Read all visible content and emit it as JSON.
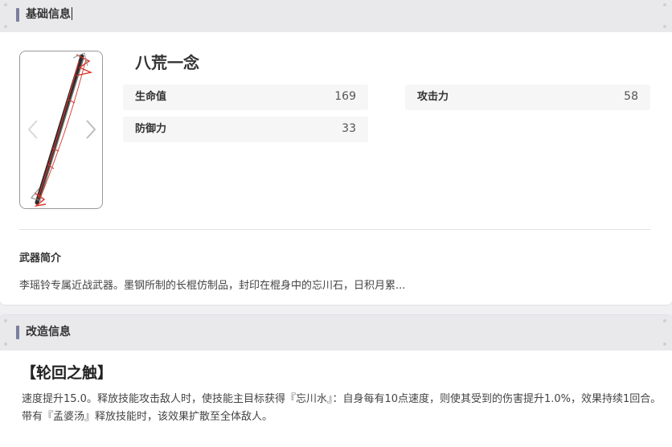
{
  "basic": {
    "header_title": "基础信息",
    "weapon_name": "八荒一念",
    "image_icon": "weapon-staff-image",
    "stats": {
      "hp_label": "生命值",
      "hp_value": "169",
      "atk_label": "攻击力",
      "atk_value": "58",
      "def_label": "防御力",
      "def_value": "33"
    },
    "intro_title": "武器简介",
    "intro_text": "李瑶铃专属近战武器。墨钢所制的长棍仿制品，封印在棍身中的忘川石，日积月累..."
  },
  "modification": {
    "header_title": "改造信息",
    "name": "【轮回之触】",
    "description": "速度提升15.0。释放技能攻击敌人时，使技能主目标获得『忘川水』：自身每有10点速度，则使其受到的伤害提升1.0%，效果持续1回合。带有『孟婆汤』释放技能时，该效果扩散至全体敌人。"
  },
  "colors": {
    "accent_bar": "#7a7f9e",
    "header_bg": "#e9e9ec",
    "stat_bg": "#f6f6f7",
    "staff_dark": "#2b2b2b",
    "staff_red": "#d9342b"
  }
}
